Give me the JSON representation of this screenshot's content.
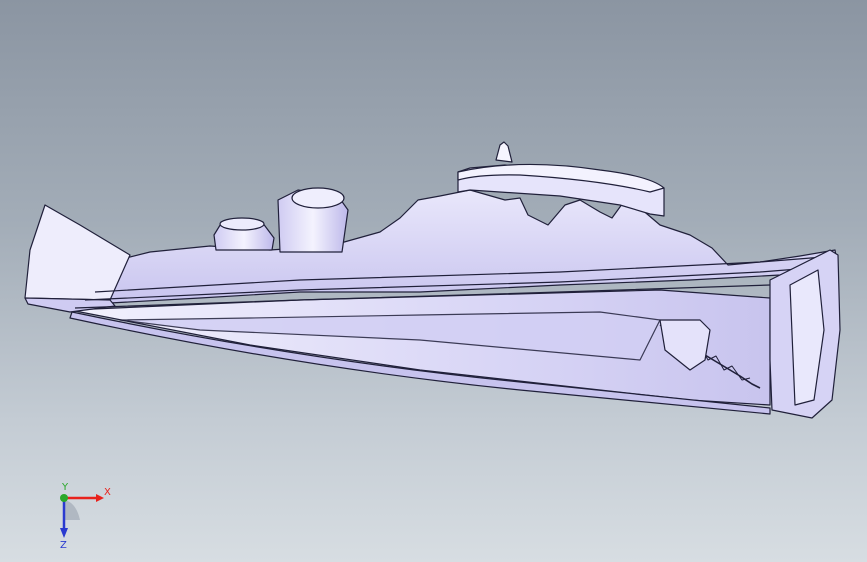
{
  "viewport": {
    "background_top": "#8b95a2",
    "background_bottom": "#d7dde2",
    "model_fill": "#dedcf7",
    "model_shade": "#c7c3ee",
    "edge_color": "#20203a"
  },
  "triad": {
    "x_label": "X",
    "y_label": "Y",
    "z_label": "Z",
    "x_color": "#e8221c",
    "y_color": "#2aa82a",
    "z_color": "#2a3ad0"
  }
}
